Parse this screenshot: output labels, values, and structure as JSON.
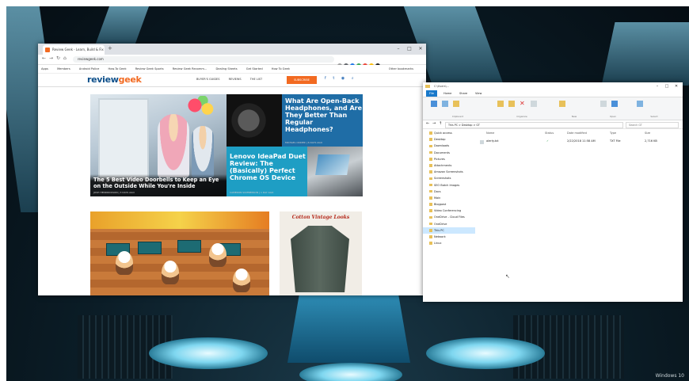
{
  "desktop": {
    "watermark": "Windows 10"
  },
  "chrome": {
    "tab_title": "Review Geek - Learn, Build & Fix",
    "new_tab": "+",
    "controls": {
      "minimize": "–",
      "maximize": "□",
      "close": "✕"
    },
    "nav": {
      "back": "←",
      "forward": "→",
      "reload": "↻",
      "home": "⌂"
    },
    "url": "reviewgeek.com",
    "bookmarks": [
      "Apps",
      "Members",
      "Android Police",
      "How-To Geek",
      "Review Geek Sports",
      "Review Geek Recomm...",
      "Dealing Sheets",
      "Get Started",
      "How To Geek"
    ],
    "other_bookmarks": "Other bookmarks",
    "ext_colors": [
      "#9e9e9e",
      "#5f6368",
      "#1a73e8",
      "#34a853",
      "#ea4335",
      "#fbbc05",
      "#202124"
    ]
  },
  "site": {
    "logo_a": "review",
    "logo_b": "geek",
    "nav_links": [
      "BUYER'S GUIDES",
      "REVIEWS",
      "THE LIST"
    ],
    "subscribe": "SUBSCRIBE",
    "social": [
      "f",
      "t",
      "◉",
      "⌕"
    ],
    "hero": {
      "title": "The 5 Best Video Doorbells to Keep an Eye on the Outside While You're Inside",
      "byline": "JOSH HENDRICKSON | 3 DAYS AGO"
    },
    "card_b": {
      "title": "What Are Open-Back Headphones, and Are They Better Than Regular Headphones?",
      "byline": "MICHAEL CRIDER | 6 DAYS AGO"
    },
    "card_c": {
      "title": "Lenovo IdeaPad Duet Review: The (Basically) Perfect Chrome OS Device",
      "byline": "CAMERON SUMMERSON | 1 DAY AGO"
    },
    "ad_title": "Cotton Vintage Looks"
  },
  "explorer": {
    "title": "C:\\Users\\...",
    "controls": {
      "minimize": "–",
      "maximize": "□",
      "close": "✕"
    },
    "tabs": [
      "File",
      "Home",
      "Share",
      "View"
    ],
    "groups": [
      "Clipboard",
      "Organize",
      "New",
      "Open",
      "Select"
    ],
    "path": "This PC  >  Desktop  >  GT",
    "search_placeholder": "Search GT",
    "nav_items": [
      "Quick access",
      "Desktop",
      "Downloads",
      "Documents",
      "Pictures",
      "Attachments",
      "Amazon Screenshots",
      "Screenshots",
      "SEO Batch Images",
      "Docs",
      "Main",
      "Blogpost",
      "Video Conferencing",
      "OneDrive - Cloud Files",
      "OneDrive",
      "This PC",
      "Network",
      "Linux"
    ],
    "selected_nav": "This PC",
    "columns": [
      "Name",
      "Status",
      "Date modified",
      "Type",
      "Size"
    ],
    "files": [
      {
        "name": "alerty.txt",
        "status": "✓",
        "date": "2/22/2018 11:58 AM",
        "type": "TXT File",
        "size": "2,716 KB"
      }
    ]
  }
}
